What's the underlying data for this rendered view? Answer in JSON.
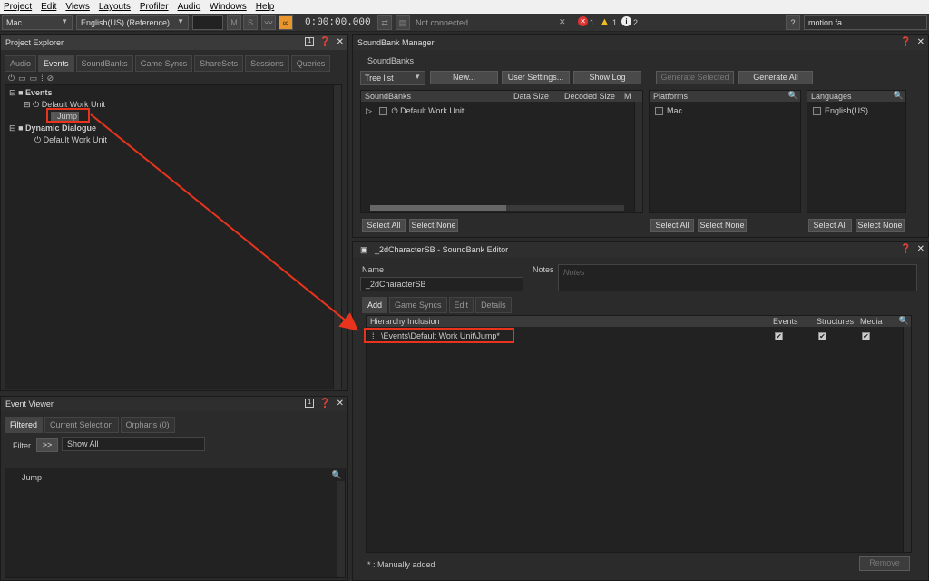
{
  "menu": [
    "Project",
    "Edit",
    "Views",
    "Layouts",
    "Profiler",
    "Audio",
    "Windows",
    "Help"
  ],
  "toolbar": {
    "platform": "Mac",
    "language": "English(US) (Reference)",
    "m": "M",
    "s": "S",
    "time": "0:00:00.000",
    "connection": "Not connected",
    "errors": "1",
    "warnings": "1",
    "infos": "2",
    "help": "?",
    "search": "motion fa"
  },
  "project_explorer": {
    "title": "Project Explorer",
    "tabs": [
      "Audio",
      "Events",
      "SoundBanks",
      "Game Syncs",
      "ShareSets",
      "Sessions",
      "Queries"
    ],
    "tree": {
      "events": "Events",
      "dwu": "Default Work Unit",
      "jump": "Jump",
      "dialogue": "Dynamic Dialogue",
      "dwu2": "Default Work Unit"
    }
  },
  "event_viewer": {
    "title": "Event Viewer",
    "tabs": [
      "Filtered",
      "Current Selection",
      "Orphans (0)"
    ],
    "filter_label": "Filter",
    "filter_btn": ">>",
    "filter_value": "Show All",
    "item": "Jump"
  },
  "sb_manager": {
    "title": "SoundBank Manager",
    "subtitle": "SoundBanks",
    "view": "Tree list",
    "new_btn": "New...",
    "user_settings": "User Settings...",
    "show_log": "Show Log",
    "gen_selected": "Generate Selected",
    "gen_all": "Generate All",
    "cols": {
      "soundbanks": "SoundBanks",
      "data_size": "Data Size",
      "decoded": "Decoded Size",
      "m": "M"
    },
    "bank_row": "Default Work Unit",
    "platforms_head": "Platforms",
    "platform": "Mac",
    "languages_head": "Languages",
    "language": "English(US)",
    "select_all": "Select All",
    "select_none": "Select None"
  },
  "sb_editor": {
    "title": "_2dCharacterSB - SoundBank Editor",
    "name_label": "Name",
    "name_value": "_2dCharacterSB",
    "notes_label": "Notes",
    "notes_placeholder": "Notes",
    "tabs": [
      "Add",
      "Game Syncs",
      "Edit",
      "Details"
    ],
    "cols": {
      "hier": "Hierarchy Inclusion",
      "events": "Events",
      "structures": "Structures",
      "media": "Media"
    },
    "row": "\\Events\\Default Work Unit\\Jump*",
    "footer": "* : Manually added",
    "remove": "Remove"
  }
}
